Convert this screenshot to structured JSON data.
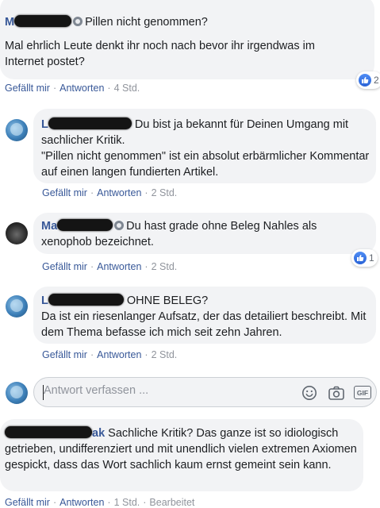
{
  "comments": [
    {
      "name": "Ma…a",
      "text_first": "Pillen nicht genommen?",
      "text_rest": "Mal ehrlich Leute denkt ihr noch nach bevor ihr irgendwas im Internet postet?",
      "like_label": "Gefällt mir",
      "reply_label": "Antworten",
      "time": "4 Std.",
      "reaction_count": "2"
    },
    {
      "name": "L…",
      "text_first": "Du bist ja bekannt für Deinen Umgang mit sachlicher Kritik.",
      "text_rest": "\"Pillen nicht genommen\" ist ein absolut erbärmlicher Kommentar auf einen langen fundierten Artikel.",
      "like_label": "Gefällt mir",
      "reply_label": "Antworten",
      "time": "2 Std."
    },
    {
      "name": "Ma…",
      "text_first": "Du hast grade ohne Beleg Nahles als xenophob bezeichnet.",
      "like_label": "Gefällt mir",
      "reply_label": "Antworten",
      "time": "2 Std.",
      "reaction_count": "1"
    },
    {
      "name": "Lo…t",
      "text_first": "OHNE BELEG?",
      "text_rest": "Da ist ein riesenlanger Aufsatz, der das detailiert beschreibt. Mit dem Thema befasse ich mich seit zehn Jahren.",
      "like_label": "Gefällt mir",
      "reply_label": "Antworten",
      "time": "2 Std."
    },
    {
      "name": "M…ak",
      "text_first": "Sachliche Kritik? Das ganze ist so idiologisch getrieben, undifferenziert und mit unendlich vielen extremen Axiomen gespickt, dass das Wort sachlich kaum ernst gemeint sein kann.",
      "like_label": "Gefällt mir",
      "reply_label": "Antworten",
      "time": "1 Std.",
      "edited_label": "Bearbeitet"
    }
  ],
  "reply": {
    "placeholder": "Antwort verfassen ...",
    "icons": [
      "emoji-icon",
      "camera-icon",
      "gif-icon"
    ],
    "gif_label": "GIF"
  },
  "colors": {
    "link": "#385898",
    "bubble": "#f2f3f5",
    "meta": "#90949c",
    "like_blue": "#2a63d6"
  }
}
